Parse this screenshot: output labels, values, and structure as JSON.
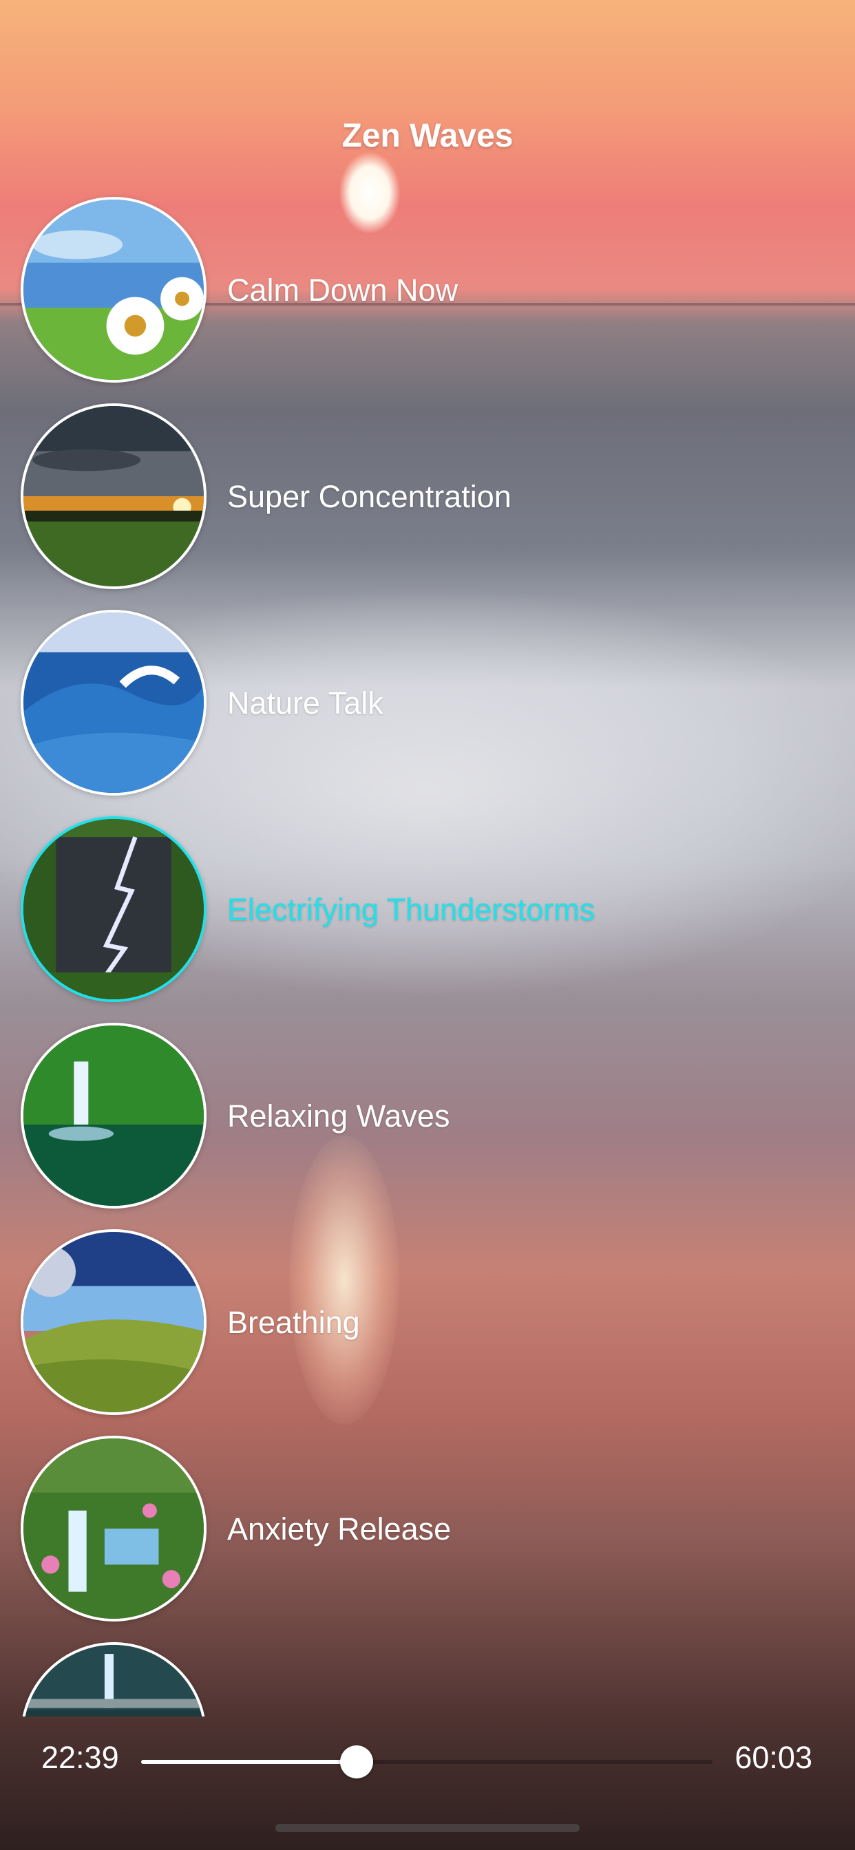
{
  "app": {
    "title": "Zen Waves"
  },
  "tracks": [
    {
      "label": "Calm Down Now",
      "thumb_icon": "daisy-meadow-image",
      "active": false
    },
    {
      "label": "Super Concentration",
      "thumb_icon": "sunset-field-image",
      "active": false
    },
    {
      "label": "Nature Talk",
      "thumb_icon": "ocean-wave-image",
      "active": false
    },
    {
      "label": "Electrifying Thunderstorms",
      "thumb_icon": "lightning-storm-image",
      "active": true
    },
    {
      "label": "Relaxing Waves",
      "thumb_icon": "waterfall-lagoon-image",
      "active": false
    },
    {
      "label": "Breathing",
      "thumb_icon": "moon-hills-image",
      "active": false
    },
    {
      "label": "Anxiety Release",
      "thumb_icon": "cascade-flowers-image",
      "active": false
    },
    {
      "label": "",
      "thumb_icon": "waterfall-bridge-image",
      "active": false
    }
  ],
  "player": {
    "elapsed": "22:39",
    "total": "60:03",
    "progress": 0.3772
  },
  "colors": {
    "accent": "#22e0e8",
    "text": "#ffffff"
  }
}
